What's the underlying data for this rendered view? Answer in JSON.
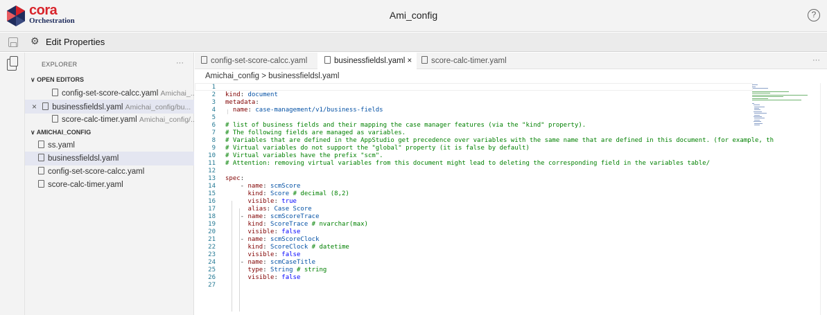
{
  "app": {
    "logo_main": "cora",
    "logo_sub": "Orchestration",
    "title": "Ami_config",
    "help_glyph": "?"
  },
  "toolbar": {
    "edit_properties_label": "Edit Properties"
  },
  "sidebar": {
    "title": "EXPLORER",
    "more": "···",
    "open_editors_label": "OPEN EDITORS",
    "open_editors": [
      {
        "name": "config-set-score-calcc.yaml",
        "path": "Amichai_..."
      },
      {
        "name": "businessfieldsl.yaml",
        "path": "Amichai_config/bu..."
      },
      {
        "name": "score-calc-timer.yaml",
        "path": "Amichai_config/..."
      }
    ],
    "folder_label": "AMICHAI_CONFIG",
    "files": [
      "ss.yaml",
      "businessfieldsl.yaml",
      "config-set-score-calcc.yaml",
      "score-calc-timer.yaml"
    ]
  },
  "tabs": [
    {
      "label": "config-set-score-calcc.yaml"
    },
    {
      "label": "businessfieldsl.yaml"
    },
    {
      "label": "score-calc-timer.yaml"
    }
  ],
  "tabs_more": "···",
  "breadcrumb": {
    "folder": "Amichai_config",
    "separator": ">",
    "file": "businessfieldsl.yaml"
  },
  "icons": {
    "logo": "cora-hex-logo-icon",
    "help": "help-circle-icon",
    "save": "save-icon",
    "properties": "properties-icon",
    "explorer": "files-icon",
    "file": "file-icon",
    "close": "close-icon",
    "chevron": "chevron-down-icon"
  },
  "code": [
    {
      "n": "1",
      "html": ""
    },
    {
      "n": "2",
      "html": "<span class=\"k\">kind</span>: <span class=\"s\">document</span>"
    },
    {
      "n": "3",
      "html": "<span class=\"k\">metadata</span>:"
    },
    {
      "n": "4",
      "html": "  <span class=\"k\">name</span>: <span class=\"s\">case-management/v1/business-fields</span>"
    },
    {
      "n": "5",
      "html": ""
    },
    {
      "n": "6",
      "html": "<span class=\"c\"># list of business fields and their mapping the case manager features (via the \"kind\" property).</span>"
    },
    {
      "n": "7",
      "html": "<span class=\"c\"># The following fields are managed as variables.</span>"
    },
    {
      "n": "8",
      "html": "<span class=\"c\"># Variables that are defined in the AppStudio get precedence over variables with the same name that are defined in this document. (for example, th</span>"
    },
    {
      "n": "9",
      "html": "<span class=\"c\"># Virtual variables do not support the \"global\" property (it is false by default)</span>"
    },
    {
      "n": "10",
      "html": "<span class=\"c\"># Virtual variables have the prefix \"scm\".</span>"
    },
    {
      "n": "11",
      "html": "<span class=\"c\"># Attention: removing virtual variables from this document might lead to deleting the corresponding field in the variables table/</span>"
    },
    {
      "n": "12",
      "html": ""
    },
    {
      "n": "13",
      "html": "<span class=\"k\">spec</span>:"
    },
    {
      "n": "14",
      "html": "    - <span class=\"k\">name</span>: <span class=\"s\">scmScore</span>"
    },
    {
      "n": "15",
      "html": "      <span class=\"k\">kind</span>: <span class=\"s\">Score</span> <span class=\"c\"># decimal (8,2)</span>"
    },
    {
      "n": "16",
      "html": "      <span class=\"k\">visible</span>: <span class=\"b\">true</span>"
    },
    {
      "n": "17",
      "html": "      <span class=\"k\">alias</span>: <span class=\"s\">Case Score</span>"
    },
    {
      "n": "18",
      "html": "    - <span class=\"k\">name</span>: <span class=\"s\">scmScoreTrace</span>"
    },
    {
      "n": "19",
      "html": "      <span class=\"k\">kind</span>: <span class=\"s\">ScoreTrace</span> <span class=\"c\"># nvarchar(max)</span>"
    },
    {
      "n": "20",
      "html": "      <span class=\"k\">visible</span>: <span class=\"b\">false</span>"
    },
    {
      "n": "21",
      "html": "    - <span class=\"k\">name</span>: <span class=\"s\">scmScoreClock</span>"
    },
    {
      "n": "22",
      "html": "      <span class=\"k\">kind</span>: <span class=\"s\">ScoreClock</span> <span class=\"c\"># datetime</span>"
    },
    {
      "n": "23",
      "html": "      <span class=\"k\">visible</span>: <span class=\"b\">false</span>"
    },
    {
      "n": "24",
      "html": "    - <span class=\"k\">name</span>: <span class=\"s\">scmCaseTitle</span>"
    },
    {
      "n": "25",
      "html": "      <span class=\"k\">type</span>: <span class=\"s\">String</span> <span class=\"c\"># string</span>"
    },
    {
      "n": "26",
      "html": "      <span class=\"k\">visible</span>: <span class=\"b\">false</span>"
    },
    {
      "n": "27",
      "html": ""
    }
  ],
  "colors": {
    "keyword": "#800000",
    "string": "#0451a5",
    "comment": "#008000",
    "boolean": "#0000ff",
    "line_number": "#237893",
    "brand_red": "#d8232a",
    "brand_navy": "#1f2c5c"
  }
}
